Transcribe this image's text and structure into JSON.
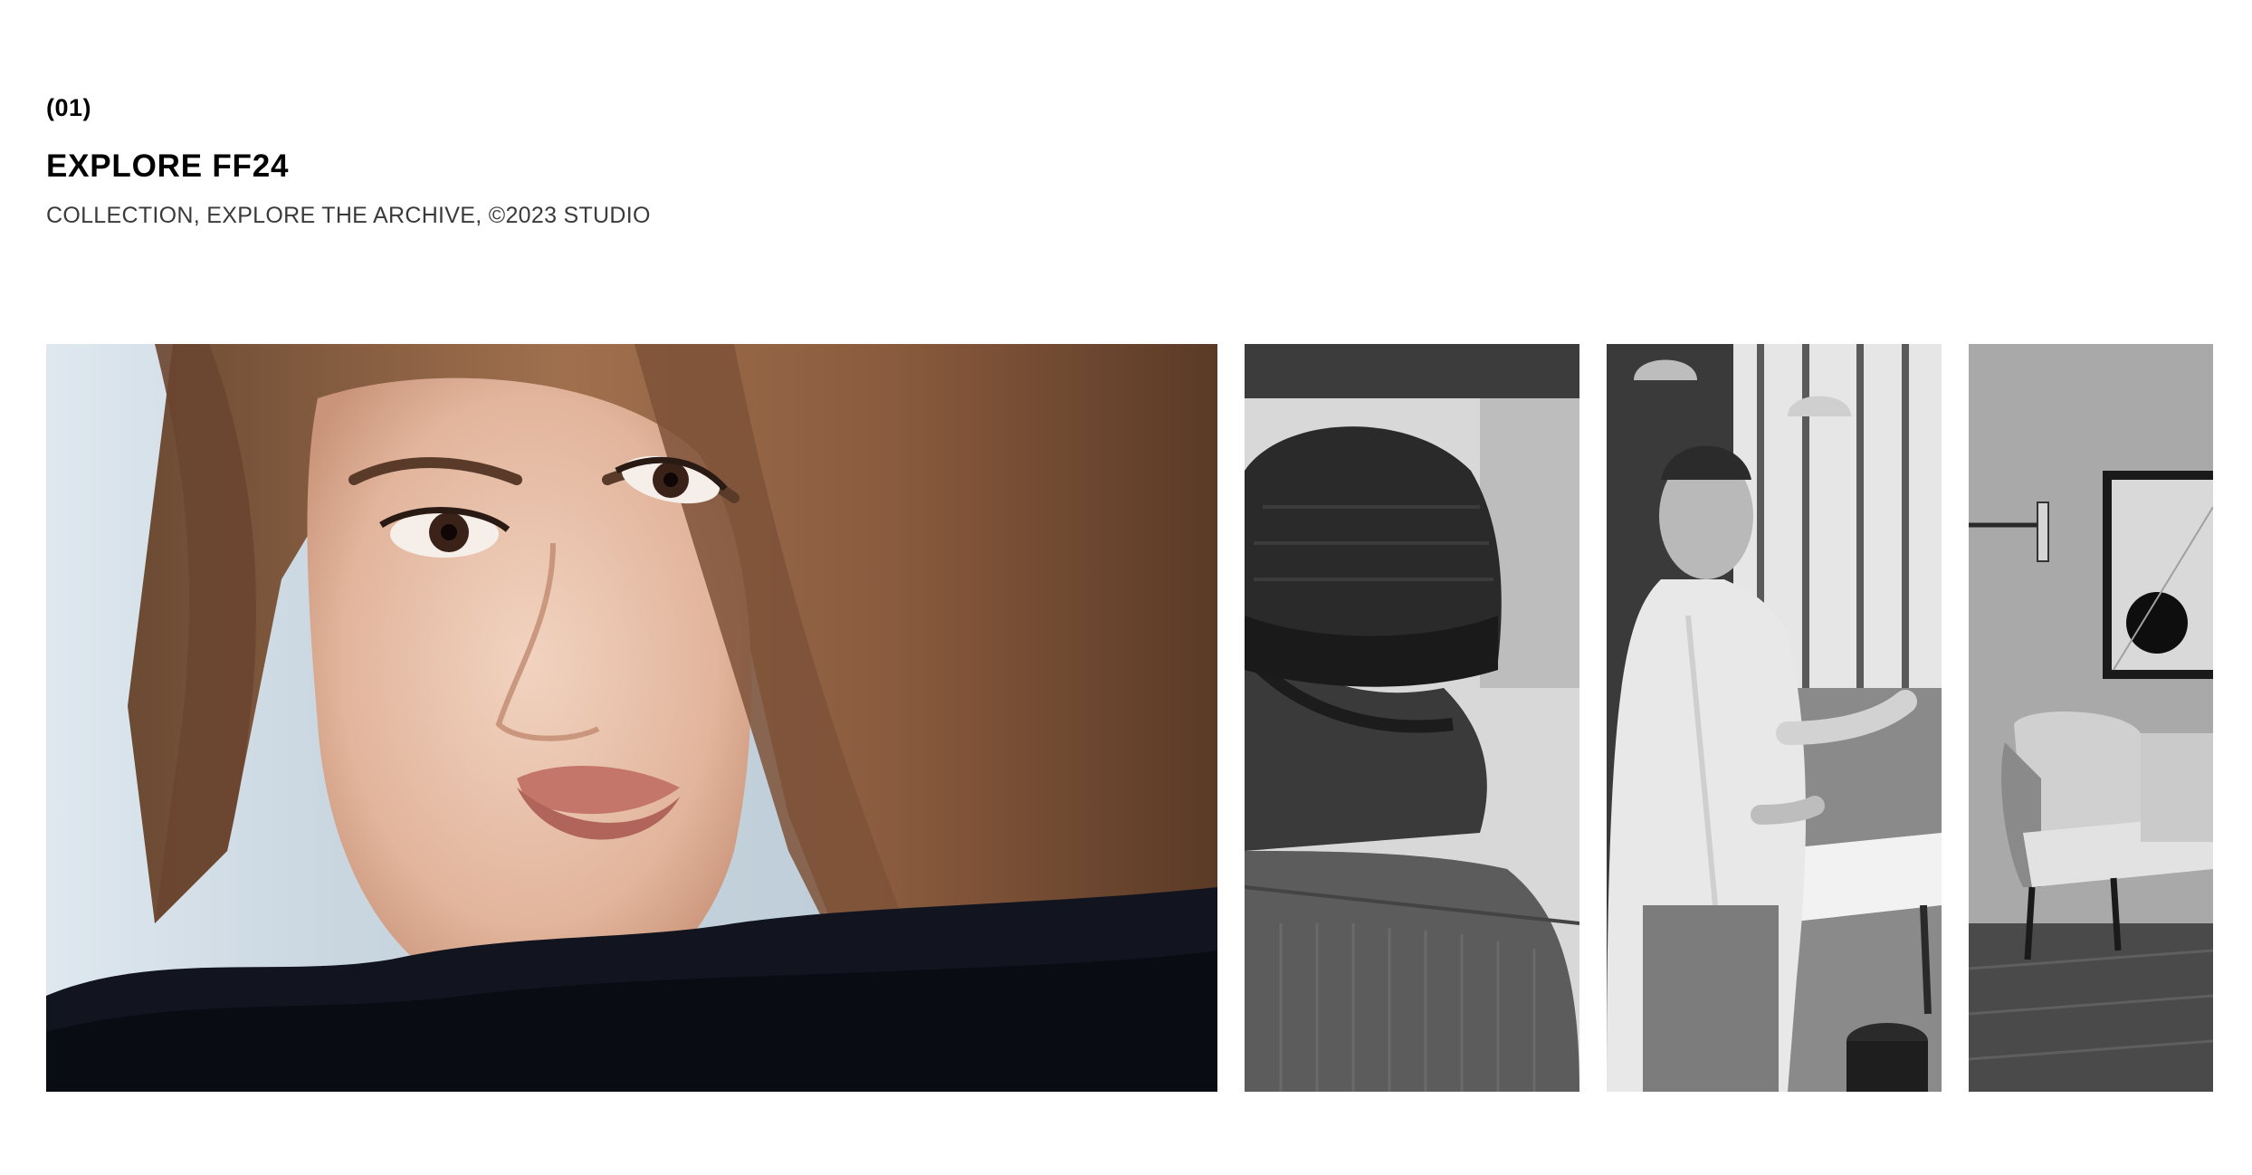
{
  "section": {
    "index": "(01)",
    "title": "EXPLORE FF24",
    "subtitle": "COLLECTION, EXPLORE THE ARCHIVE, ©2023 STUDIO"
  },
  "gallery": {
    "images": [
      {
        "subject": "woman-portrait-photo",
        "tone": "color"
      },
      {
        "subject": "man-beanie-back-photo",
        "tone": "grayscale"
      },
      {
        "subject": "man-office-gesturing-photo",
        "tone": "grayscale"
      },
      {
        "subject": "interior-armchair-photo",
        "tone": "grayscale"
      }
    ]
  }
}
